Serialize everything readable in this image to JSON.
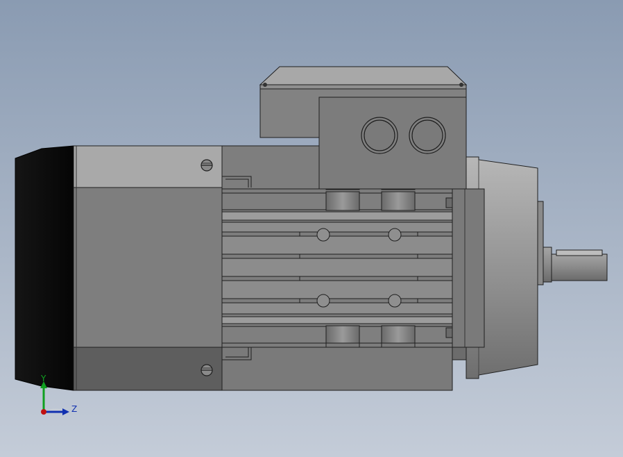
{
  "viewport": {
    "background_top": "#8a9bb2",
    "background_bottom": "#c4ccd8"
  },
  "model": {
    "icon": "electric-motor-side-view",
    "colors": {
      "body": "#7e7e7e",
      "body_light": "#a9a9a9",
      "fan_cover": "#0c0c0c",
      "outline": "#1e1e1e",
      "flange": "#8c8c8c"
    }
  },
  "triad": {
    "y_label": "Y",
    "z_label": "Z",
    "y_color": "#10a020",
    "z_color": "#1030b0",
    "origin_color": "#c01010"
  }
}
